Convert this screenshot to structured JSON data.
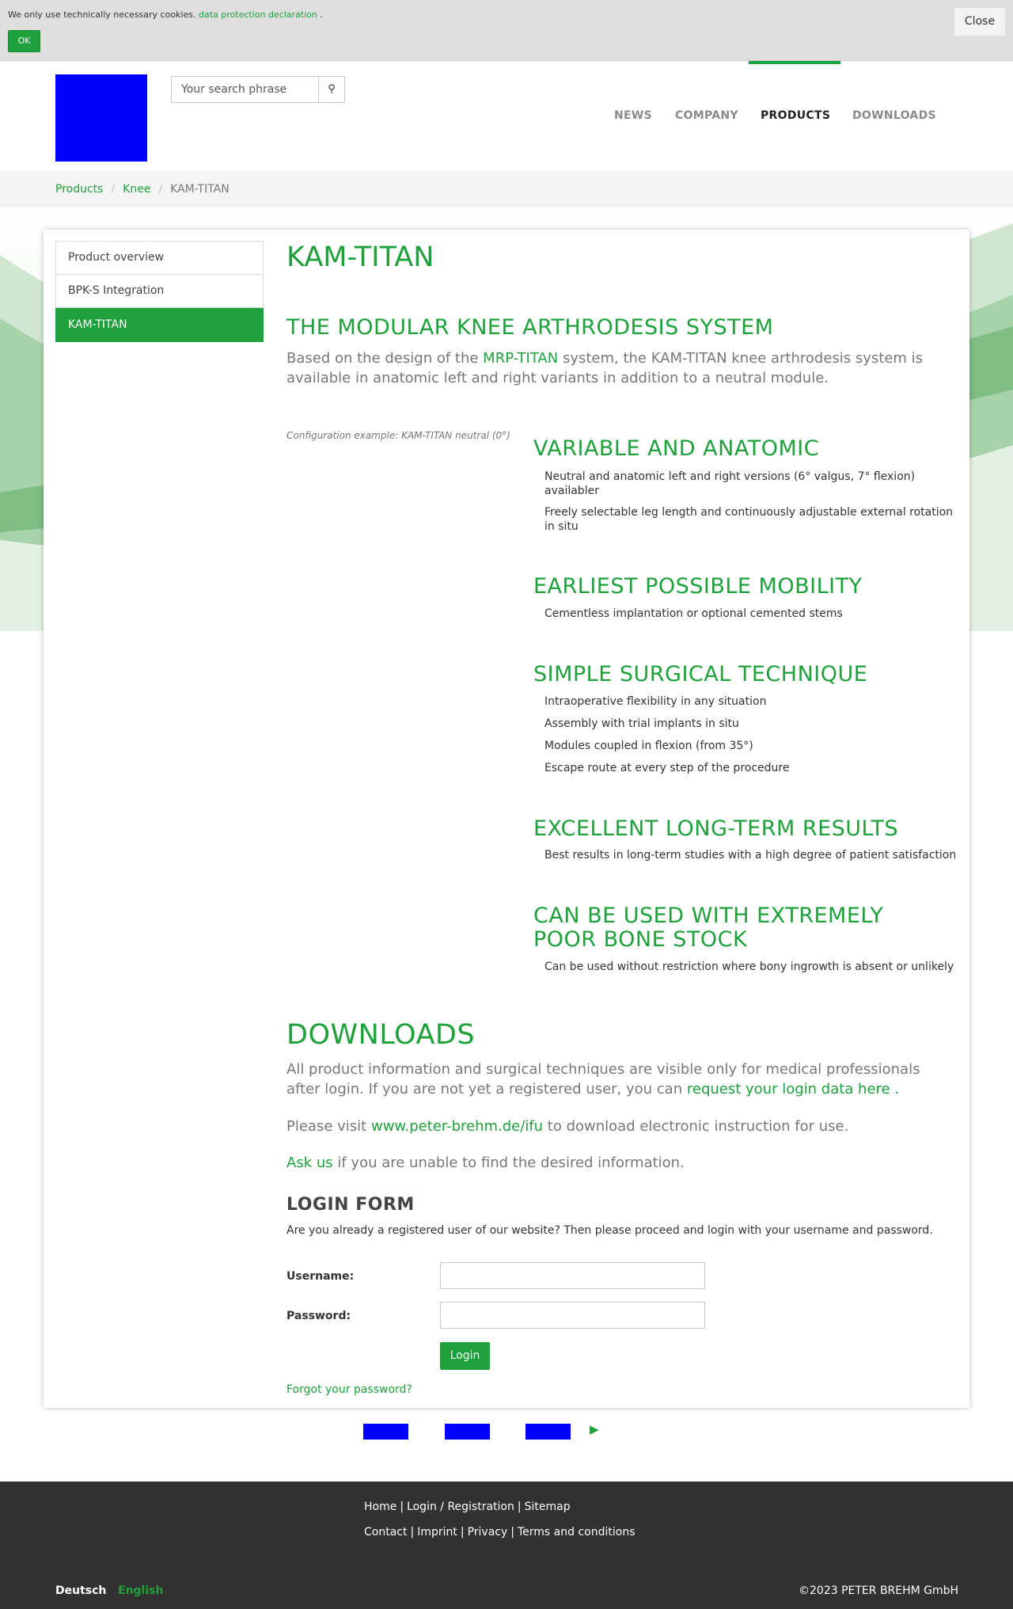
{
  "cookie": {
    "text": "We only use technically necessary cookies.",
    "link": "data protection declaration",
    "after": ".",
    "ok": "OK",
    "close": "Close"
  },
  "header": {
    "search_placeholder": "Your search phrase",
    "search_icon": "search-icon",
    "nav": [
      "NEWS",
      "COMPANY",
      "PRODUCTS",
      "DOWNLOADS"
    ],
    "nav_active": "PRODUCTS",
    "accent": "#1ea03b"
  },
  "breadcrumb": [
    "Products",
    "Knee",
    "KAM-TITAN"
  ],
  "sidebar": [
    "Product overview",
    "BPK-S Integration",
    "KAM-TITAN"
  ],
  "main": {
    "title": "KAM-TITAN",
    "subtitle": "THE MODULAR KNEE ARTHRODESIS SYSTEM",
    "lead_before": "Based on the design of the",
    "lead_link": "MRP-TITAN",
    "lead_after": "system, the KAM-TITAN knee arthrodesis system is available in anatomic left and right variants in addition to a neutral module.",
    "caption": "Configuration example: KAM-TITAN neutral (0°)",
    "features": [
      {
        "heading": "VARIABLE AND ANATOMIC",
        "items": [
          "Neutral and anatomic left and right versions (6° valgus, 7° flexion) availabler",
          "Freely selectable leg length and continuously adjustable external rotation in situ"
        ]
      },
      {
        "heading": "EARLIEST POSSIBLE MOBILITY",
        "items": [
          "Cementless implantation or optional cemented stems"
        ]
      },
      {
        "heading": "SIMPLE SURGICAL TECHNIQUE",
        "items": [
          "Intraoperative flexibility in any situation",
          "Assembly with trial implants in situ",
          "Modules coupled in flexion (from 35°)",
          "Escape route at every step of the procedure"
        ]
      },
      {
        "heading": "EXCELLENT LONG-TERM RESULTS",
        "items": [
          "Best results in long-term studies with a high degree of patient satisfaction"
        ]
      },
      {
        "heading_line1": "CAN BE USED WITH EXTREMELY",
        "heading_line2": "POOR BONE STOCK",
        "items": [
          "Can be used without restriction where bony ingrowth is absent or unlikely"
        ]
      }
    ]
  },
  "downloads": {
    "title": "DOWNLOADS",
    "p1_line1": "All product information and surgical techniques are visible only for medical professionals",
    "p1_line2": "after login. If you are not yet a registered user, you can",
    "p1_link": "request your login data here",
    "p1_end": ".",
    "p2_before": "Please visit",
    "p2_link": "www.peter-brehm.de/ifu",
    "p2_after": "to download electronic instruction for use.",
    "p3_link": "Ask us",
    "p3_after": "if you are unable to find the desired information."
  },
  "login": {
    "title": "LOGIN FORM",
    "intro": "Are you already a registered user of our website? Then please proceed and login with your username and password.",
    "username_label": "Username:",
    "password_label": "Password:",
    "button": "Login",
    "forgot": "Forgot your password?"
  },
  "footer": {
    "row1": [
      "Home",
      "Login / Registration",
      "Sitemap"
    ],
    "row2": [
      "Contact",
      "Imprint",
      "Privacy",
      "Terms and conditions"
    ],
    "lang_de": "Deutsch",
    "lang_en": "English",
    "copyright": "©2023 PETER BREHM GmbH"
  }
}
